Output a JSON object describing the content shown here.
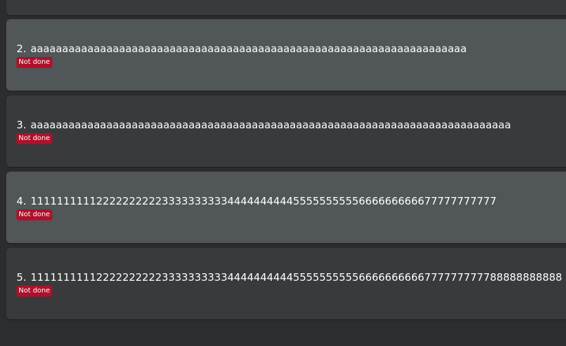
{
  "tasks": [
    {
      "index": "2.",
      "text": "aaaaaaaaaaaaaaaaaaaaaaaaaaaaaaaaaaaaaaaaaaaaaaaaaaaaaaaaaaaaaaaaaaaaa",
      "status": "Not done"
    },
    {
      "index": "3.",
      "text": "aaaaaaaaaaaaaaaaaaaaaaaaaaaaaaaaaaaaaaaaaaaaaaaaaaaaaaaaaaaaaaaaaaaaaaaaaaaa",
      "status": "Not done"
    },
    {
      "index": "4.",
      "text": "11111111112222222222333333333344444444445555555555666666666677777777777",
      "status": "Not done"
    },
    {
      "index": "5.",
      "text": "111111111122222222223333333333444444444455555555556666666666777777777788888888888",
      "status": "Not done"
    }
  ],
  "colors": {
    "background": "#2c2d2f",
    "card_dark": "#393a3c",
    "card_selected": "#515658",
    "status_not_done": "#b0102a",
    "text": "#ffffff"
  }
}
